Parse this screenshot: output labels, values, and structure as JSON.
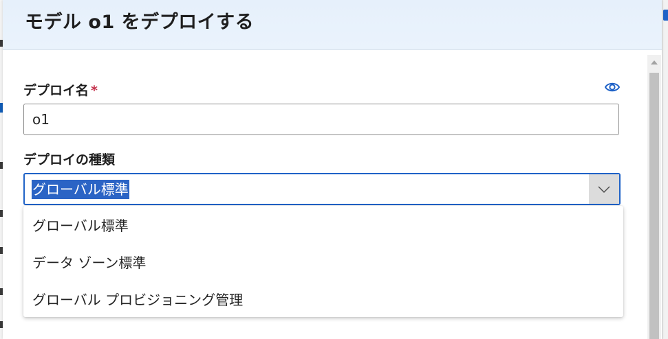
{
  "dialog": {
    "title": "モデル o1 をデプロイする"
  },
  "deployment_name": {
    "label": "デプロイ名",
    "required_marker": "*",
    "value": "o1",
    "reveal_icon": "eye-icon"
  },
  "deployment_type": {
    "label": "デプロイの種類",
    "selected": "グローバル標準",
    "options": [
      "グローバル標準",
      "データ ゾーン標準",
      "グローバル プロビジョニング管理"
    ]
  },
  "colors": {
    "accent": "#1f62c7",
    "selection": "#2b64c5",
    "header_bg": "#e6f0fb",
    "required": "#c4314b"
  }
}
